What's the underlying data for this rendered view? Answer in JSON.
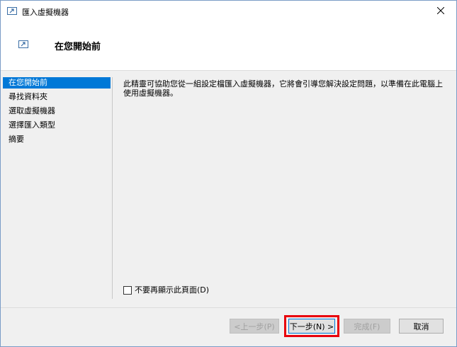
{
  "window": {
    "title": "匯入虛擬機器",
    "header_title": "在您開始前"
  },
  "nav": {
    "items": [
      {
        "label": "在您開始前",
        "active": true
      },
      {
        "label": "尋找資料夾",
        "active": false
      },
      {
        "label": "選取虛擬機器",
        "active": false
      },
      {
        "label": "選擇匯入類型",
        "active": false
      },
      {
        "label": "摘要",
        "active": false
      }
    ]
  },
  "content": {
    "description": "此精靈可協助您從一組設定檔匯入虛擬機器，它將會引導您解決設定問題，以準備在此電腦上使用虛擬機器。",
    "checkbox_label": "不要再顯示此頁面(D)",
    "checkbox_checked": false
  },
  "buttons": {
    "back": "<上一步(P)",
    "next": "下一步(N) >",
    "finish": "完成(F)",
    "cancel": "取消"
  },
  "colors": {
    "accent": "#0078d7",
    "highlight": "#e8000b"
  }
}
